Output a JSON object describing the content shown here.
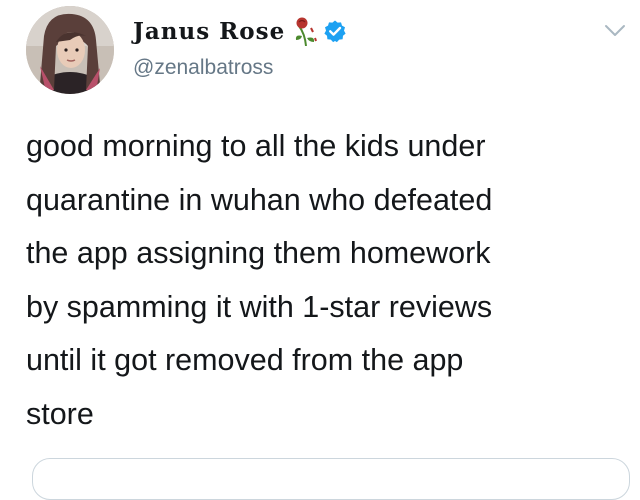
{
  "tweet": {
    "author": {
      "display_name": "Janus Rose",
      "handle": "@zenalbatross",
      "verified": true,
      "name_emoji": "wilted-rose-icon"
    },
    "body_lines": [
      "good morning to all the kids under",
      "quarantine in wuhan who defeated",
      "the app assigning them homework",
      "by spamming it with 1-star reviews",
      "until it got removed from the app",
      "store"
    ],
    "menu_icon": "chevron-down-icon"
  },
  "colors": {
    "text": "#14171a",
    "secondary_text": "#657786",
    "verified_blue": "#1da1f2",
    "card_border": "#ccd6dd"
  }
}
